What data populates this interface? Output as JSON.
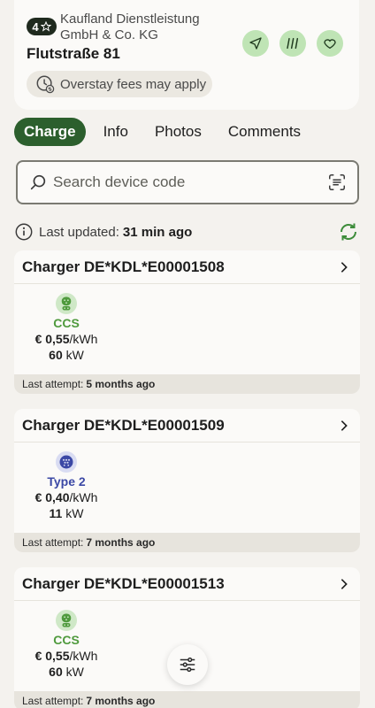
{
  "station": {
    "rating": "4",
    "operator_line1": "Kaufland Dienstleistung",
    "operator_line2": "GmbH & Co. KG",
    "address": "Flutstraße 81",
    "overstay_notice": "Overstay fees may apply",
    "actions": [
      "navigate-icon",
      "route-icon",
      "heart-icon"
    ]
  },
  "tabs": [
    {
      "label": "Charge",
      "active": true
    },
    {
      "label": "Info",
      "active": false
    },
    {
      "label": "Photos",
      "active": false
    },
    {
      "label": "Comments",
      "active": false
    }
  ],
  "search": {
    "placeholder": "Search device code"
  },
  "status": {
    "label": "Last updated:",
    "value": "31 min ago"
  },
  "chargers": [
    {
      "title": "Charger DE*KDL*E00001508",
      "connector": "CCS",
      "connector_color": "#4f9a3d",
      "price_value": "€ 0,55",
      "price_unit": "/kWh",
      "power_value": "60",
      "power_unit": "kW",
      "attempt_label": "Last attempt:",
      "attempt_value": "5 months ago"
    },
    {
      "title": "Charger DE*KDL*E00001509",
      "connector": "Type 2",
      "connector_color": "#3b48a5",
      "price_value": "€ 0,40",
      "price_unit": "/kWh",
      "power_value": "11",
      "power_unit": "kW",
      "attempt_label": "Last attempt:",
      "attempt_value": "7 months ago"
    },
    {
      "title": "Charger DE*KDL*E00001513",
      "connector": "CCS",
      "connector_color": "#4f9a3d",
      "price_value": "€ 0,55",
      "price_unit": "/kWh",
      "power_value": "60",
      "power_unit": "kW",
      "attempt_label": "Last attempt:",
      "attempt_value": "7 months ago"
    }
  ],
  "colors": {
    "accent": "#2c5f2d",
    "action_bg": "#bfe4b5",
    "ccs": "#4f9a3d",
    "type2": "#3b48a5"
  }
}
